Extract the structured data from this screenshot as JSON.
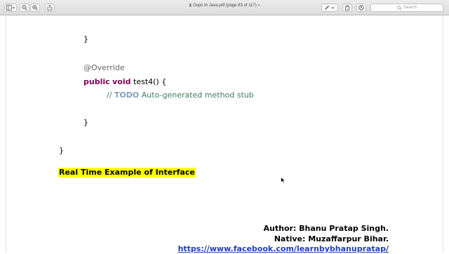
{
  "window": {
    "title": "Oops In Java.pdf (page 83 of 117)",
    "search_placeholder": "Search"
  },
  "toolbar": {
    "icons": [
      "sidebar-icon",
      "zoom-out-icon",
      "zoom-in-icon",
      "share-icon",
      "markup-pen-icon",
      "rotate-icon",
      "annotate-icon"
    ]
  },
  "document": {
    "code_lines": {
      "close_brace_1": "}",
      "annotation": "@Override",
      "kw_public": "public",
      "kw_void": "void",
      "method_rest": "test4() {",
      "comment_slashes": "//",
      "comment_todo": "TODO",
      "comment_text": "Auto-generated method stub",
      "close_brace_2": "}",
      "close_brace_3": "}"
    },
    "heading": "Real Time Example of Interface",
    "author_line": "Author: Bhanu Pratap Singh.",
    "native_line": "Native: Muzaffarpur Bihar.",
    "link": "https://www.facebook.com/learnbybhanupratap/"
  }
}
